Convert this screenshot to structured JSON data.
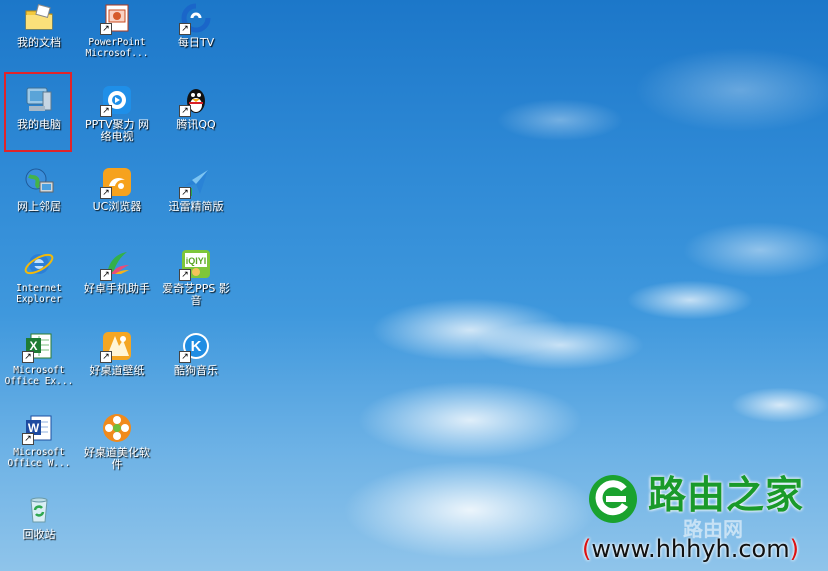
{
  "desktop": {
    "icons": [
      {
        "label": "我的文档"
      },
      {
        "label": "PowerPoint\nMicrosof..."
      },
      {
        "label": "每日TV"
      },
      {
        "label": "我的电脑"
      },
      {
        "label": "PPTV聚力 网\n络电视"
      },
      {
        "label": "腾讯QQ"
      },
      {
        "label": "网上邻居"
      },
      {
        "label": "UC浏览器"
      },
      {
        "label": "迅雷精简版"
      },
      {
        "label": "Internet\nExplorer"
      },
      {
        "label": "好卓手机助手"
      },
      {
        "label": "爱奇艺PPS 影\n音"
      },
      {
        "label": "Microsoft\nOffice Ex..."
      },
      {
        "label": "好桌道壁纸"
      },
      {
        "label": "酷狗音乐"
      },
      {
        "label": "Microsoft\nOffice W..."
      },
      {
        "label": "好桌道美化软\n件"
      },
      {
        "label": "回收站"
      }
    ],
    "selected_icon": "我的电脑"
  },
  "watermark": {
    "title": "路由之家",
    "subtitle": "路由网",
    "url_open": "(",
    "url": "www.hhhyh.com",
    "url_close": ")"
  }
}
